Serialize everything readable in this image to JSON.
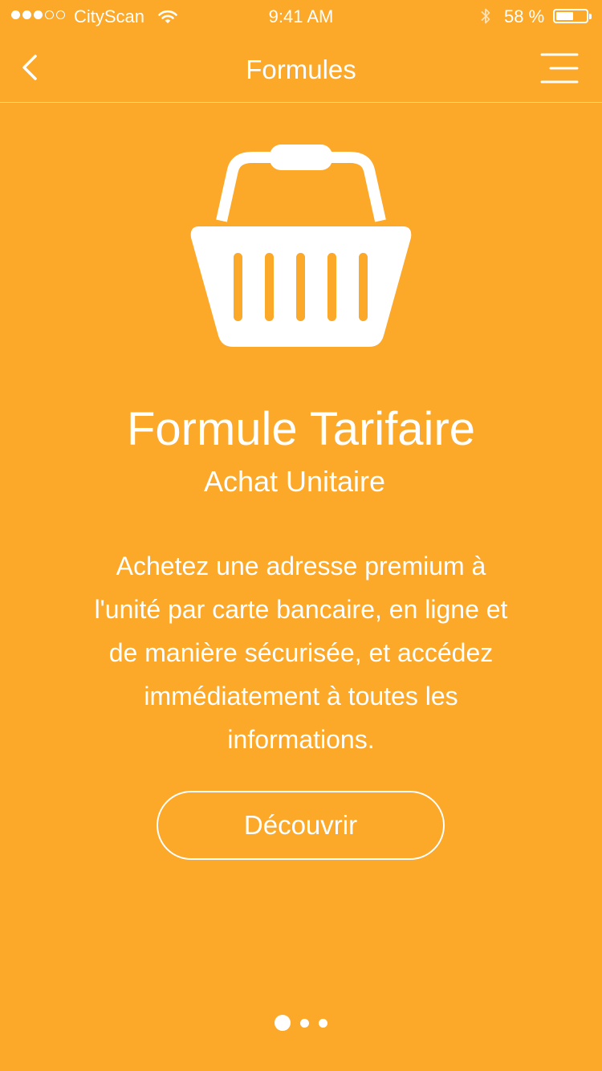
{
  "status_bar": {
    "carrier": "CityScan",
    "time": "9:41 AM",
    "battery_percent_label": "58 %",
    "battery_level": 0.58,
    "signal_bars_filled": 3,
    "signal_bars_total": 5
  },
  "nav": {
    "title": "Formules",
    "back_icon": "chevron-left-icon",
    "menu_icon": "hamburger-menu-icon"
  },
  "plan": {
    "icon": "shopping-basket-icon",
    "title": "Formule Tarifaire",
    "subtitle": "Achat Unitaire",
    "description": "Achetez une adresse premium à l'unité par carte bancaire, en ligne et de manière sécurisée, et accédez immédiatement à toutes les informations.",
    "cta_label": "Découvrir"
  },
  "pager": {
    "total_pages": 3,
    "current_page": 1
  },
  "colors": {
    "background": "#FCA828",
    "foreground": "#FFFFFF"
  }
}
